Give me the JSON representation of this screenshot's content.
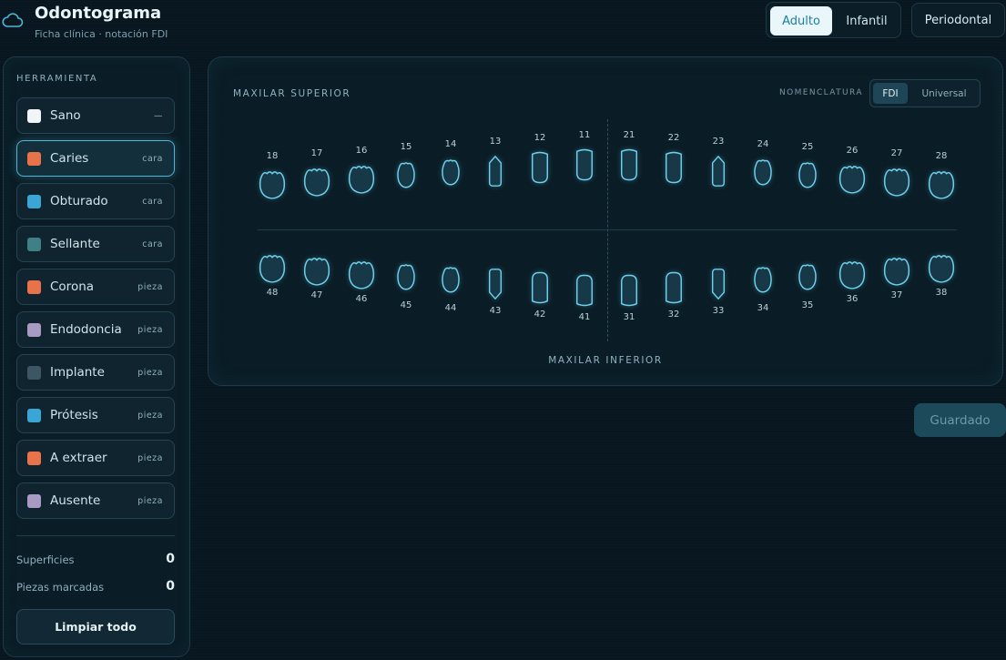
{
  "header": {
    "title": "Odontograma",
    "subtitle": "Ficha clínica · notación FDI",
    "modes": [
      {
        "label": "Adulto",
        "active": true
      },
      {
        "label": "Infantil",
        "active": false
      }
    ],
    "perio_label": "Periodontal"
  },
  "sidebar": {
    "heading": "HERRAMIENTA",
    "tools": [
      {
        "label": "Sano",
        "tag": "—",
        "color": "#f2f5f7",
        "active": false
      },
      {
        "label": "Caries",
        "tag": "cara",
        "color": "#e8734a",
        "active": true
      },
      {
        "label": "Obturado",
        "tag": "cara",
        "color": "#3aa6d6",
        "active": false
      },
      {
        "label": "Sellante",
        "tag": "cara",
        "color": "#3f7f86",
        "active": false
      },
      {
        "label": "Corona",
        "tag": "pieza",
        "color": "#e8734a",
        "active": false
      },
      {
        "label": "Endodoncia",
        "tag": "pieza",
        "color": "#a99ac4",
        "active": false
      },
      {
        "label": "Implante",
        "tag": "pieza",
        "color": "#3d5663",
        "active": false
      },
      {
        "label": "Prótesis",
        "tag": "pieza",
        "color": "#3aa6d6",
        "active": false
      },
      {
        "label": "A extraer",
        "tag": "pieza",
        "color": "#e8734a",
        "active": false
      },
      {
        "label": "Ausente",
        "tag": "pieza",
        "color": "#a99ac4",
        "active": false
      }
    ],
    "stats": [
      {
        "label": "Superficies",
        "value": "0"
      },
      {
        "label": "Piezas marcadas",
        "value": "0"
      }
    ],
    "clear_label": "Limpiar todo"
  },
  "chart": {
    "upper_label": "MAXILAR SUPERIOR",
    "lower_label": "MAXILAR INFERIOR",
    "nomenclature_label": "NOMENCLATURA",
    "nomenclature_options": [
      {
        "label": "FDI",
        "active": true
      },
      {
        "label": "Universal",
        "active": false
      }
    ],
    "upper_teeth": [
      {
        "num": "18",
        "shape": "molar"
      },
      {
        "num": "17",
        "shape": "molar"
      },
      {
        "num": "16",
        "shape": "molar"
      },
      {
        "num": "15",
        "shape": "premolar"
      },
      {
        "num": "14",
        "shape": "premolar"
      },
      {
        "num": "13",
        "shape": "canine"
      },
      {
        "num": "12",
        "shape": "incisor"
      },
      {
        "num": "11",
        "shape": "incisor"
      },
      {
        "num": "21",
        "shape": "incisor"
      },
      {
        "num": "22",
        "shape": "incisor"
      },
      {
        "num": "23",
        "shape": "canine"
      },
      {
        "num": "24",
        "shape": "premolar"
      },
      {
        "num": "25",
        "shape": "premolar"
      },
      {
        "num": "26",
        "shape": "molar"
      },
      {
        "num": "27",
        "shape": "molar"
      },
      {
        "num": "28",
        "shape": "molar"
      }
    ],
    "lower_teeth": [
      {
        "num": "48",
        "shape": "molar"
      },
      {
        "num": "47",
        "shape": "molar"
      },
      {
        "num": "46",
        "shape": "molar"
      },
      {
        "num": "45",
        "shape": "premolar"
      },
      {
        "num": "44",
        "shape": "premolar"
      },
      {
        "num": "43",
        "shape": "canine"
      },
      {
        "num": "42",
        "shape": "incisor"
      },
      {
        "num": "41",
        "shape": "incisor"
      },
      {
        "num": "31",
        "shape": "incisor"
      },
      {
        "num": "32",
        "shape": "incisor"
      },
      {
        "num": "33",
        "shape": "canine"
      },
      {
        "num": "34",
        "shape": "premolar"
      },
      {
        "num": "35",
        "shape": "premolar"
      },
      {
        "num": "36",
        "shape": "molar"
      },
      {
        "num": "37",
        "shape": "molar"
      },
      {
        "num": "38",
        "shape": "molar"
      }
    ]
  },
  "save_label": "Guardado"
}
